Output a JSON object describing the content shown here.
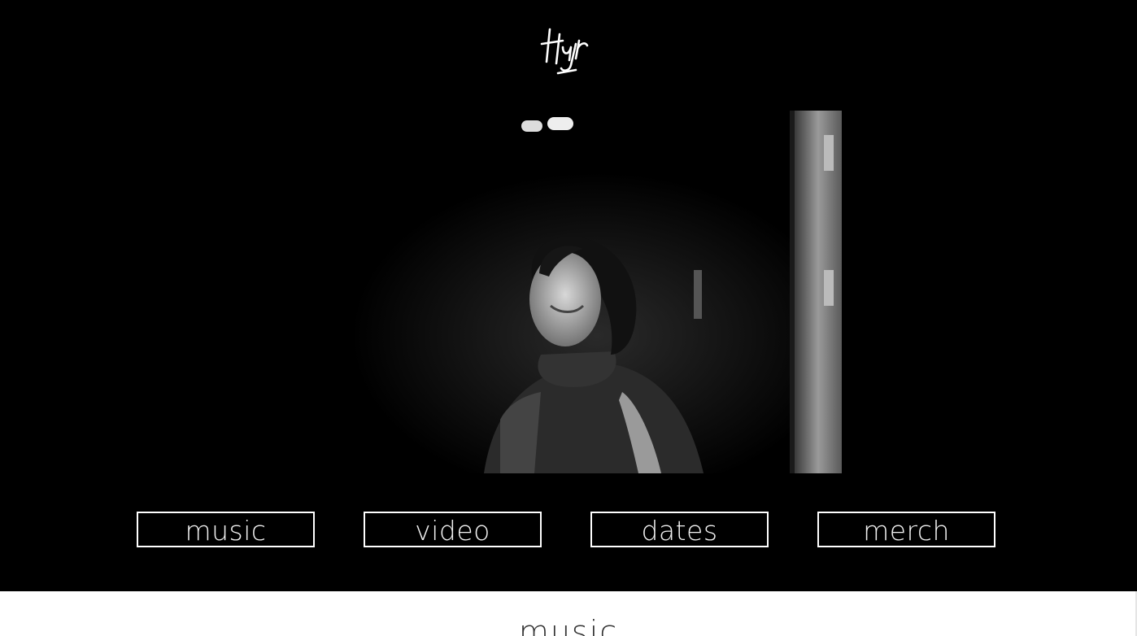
{
  "header": {
    "logo_icon": "signature-logo-icon"
  },
  "hero": {
    "photo_subject": "hero-portrait"
  },
  "nav": {
    "items": [
      {
        "label": "music"
      },
      {
        "label": "video"
      },
      {
        "label": "dates"
      },
      {
        "label": "merch"
      }
    ]
  },
  "section": {
    "heading": "music"
  },
  "colors": {
    "background": "#000000",
    "button_border": "#ffffff",
    "button_text": "#f2f2f2",
    "content_background": "#ffffff",
    "heading_text": "#333333"
  }
}
